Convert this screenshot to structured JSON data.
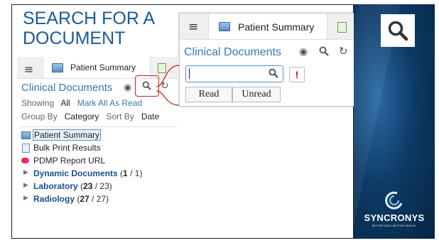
{
  "slide": {
    "title_line1": "SEARCH FOR A",
    "title_line2": "DOCUMENT"
  },
  "app": {
    "tab_label": "Patient Summary",
    "section_title": "Clinical Documents",
    "showing_label": "Showing",
    "showing_value": "All",
    "mark_all_label": "Mark All As Read",
    "group_by_label": "Group By",
    "group_by_value": "Category",
    "sort_by_label": "Sort By",
    "sort_by_value": "Date",
    "tree": {
      "patient_summary": "Patient Summary",
      "bulk_print": "Bulk Print Results",
      "pdmp": "PDMP Report URL",
      "cat1_name": "Dynamic Documents",
      "cat1_unread": "1",
      "cat1_total": "1",
      "cat2_name": "Laboratory",
      "cat2_unread": "23",
      "cat2_total": "23",
      "cat3_name": "Radiology",
      "cat3_unread": "27",
      "cat3_total": "27"
    }
  },
  "zoom": {
    "tab_label": "Patient Summary",
    "section_title": "Clinical Documents",
    "search_value": "",
    "alert_symbol": "!",
    "read_button": "Read",
    "unread_button": "Unread"
  },
  "brand": {
    "name": "SYNCRONYS",
    "tagline": "BETTER DATA. BETTER HEALTH."
  },
  "colors": {
    "title": "#1a5a9a",
    "link": "#3a78b0",
    "highlight": "#cc2222",
    "brand_bg": "#0d3a66"
  }
}
